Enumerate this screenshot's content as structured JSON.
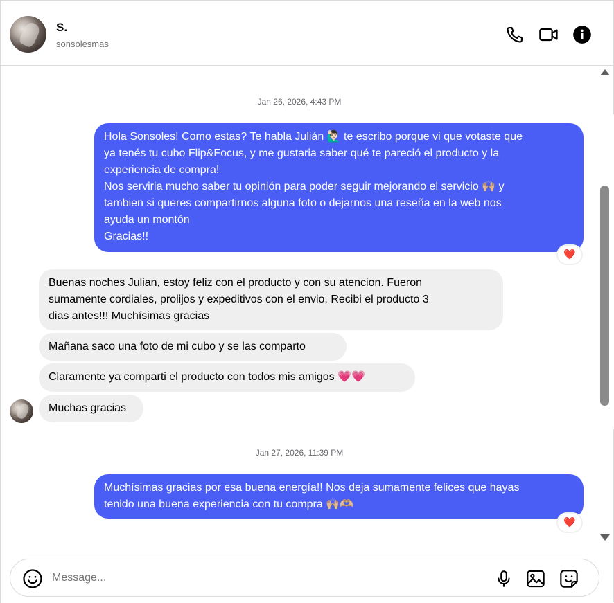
{
  "contact": {
    "name": "S.",
    "username": "sonsolesmas"
  },
  "composer": {
    "placeholder": "Message..."
  },
  "colors": {
    "outgoing_bubble": "#4a5df5",
    "incoming_bubble": "#efefef",
    "reaction_heart": "#ff3b6b"
  },
  "icons": {
    "call": "phone-icon",
    "video": "video-camera-icon",
    "info": "info-icon",
    "emoji": "emoji-icon",
    "mic": "microphone-icon",
    "gallery": "image-icon",
    "sticker": "sticker-icon"
  },
  "thread": {
    "timestamp_1": "Jan 26, 2026, 4:43 PM",
    "msg_out_1": {
      "lines": [
        "Hola Sonsoles! Como estas? Te habla Julián 🙋🏻‍♂️ te escribo porque vi que votaste que",
        "ya tenés tu cubo Flip&Focus, y me gustaria saber qué te pareció el producto y la",
        "experiencia de compra!",
        "Nos serviria mucho saber tu opinión para poder seguir mejorando el servicio 🙌🏼 y",
        "tambien si queres compartirnos alguna foto o dejarnos una reseña en la web nos",
        "ayuda un montón",
        "Gracias!!"
      ],
      "reaction": "❤️"
    },
    "msg_in_1": {
      "lines": [
        "Buenas noches Julian, estoy feliz con el producto y con su atencion. Fueron",
        "sumamente cordiales, prolijos y expeditivos con el envio. Recibi el producto 3",
        "dias antes!!! Muchísimas gracias"
      ]
    },
    "msg_in_2": "Mañana saco una foto de mi cubo y se las comparto",
    "msg_in_3": "Claramente ya comparti el producto con todos mis amigos 💗💗",
    "msg_in_4": "Muchas gracias",
    "timestamp_2": "Jan 27, 2026, 11:39 PM",
    "msg_out_2": {
      "lines": [
        "Muchísimas gracias por esa buena energía!! Nos deja sumamente felices que hayas",
        "tenido una buena experiencia con tu compra 🙌🏼🫶🏼"
      ],
      "reaction": "❤️"
    }
  }
}
